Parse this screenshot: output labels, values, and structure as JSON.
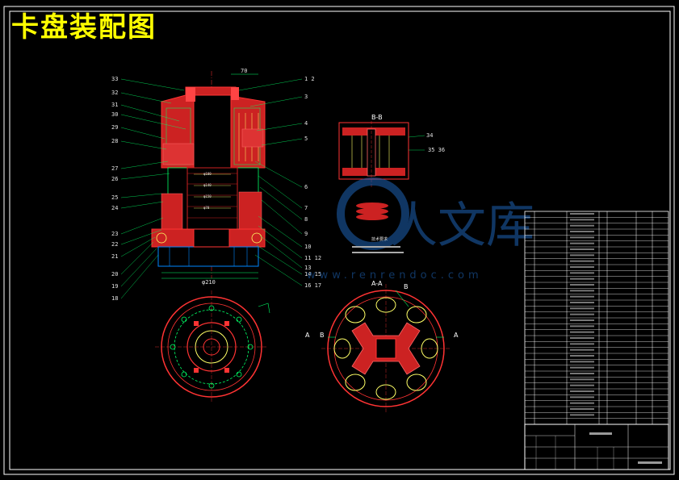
{
  "title": "卡盘装配图",
  "section_labels": {
    "bb": "B-B",
    "aa": "A-A",
    "a_left": "A",
    "a_right": "A",
    "b_left": "B",
    "b_right": "B"
  },
  "dimension_labels": {
    "top_70": "70",
    "bottom_label": "φ210"
  },
  "left_callouts": [
    "33",
    "32",
    "31",
    "30",
    "29",
    "28",
    "27",
    "26",
    "25",
    "24",
    "23",
    "22",
    "21",
    "20",
    "19",
    "18"
  ],
  "right_callouts": [
    "1 2",
    "3",
    "4",
    "5",
    "6",
    "7",
    "8",
    "9",
    "10",
    "11 12",
    "13",
    "14 15",
    "16 17"
  ],
  "bb_callouts": [
    "34",
    "35 36"
  ],
  "watermark": {
    "line1": "人文库",
    "line2": "www.renrendoc.com"
  }
}
